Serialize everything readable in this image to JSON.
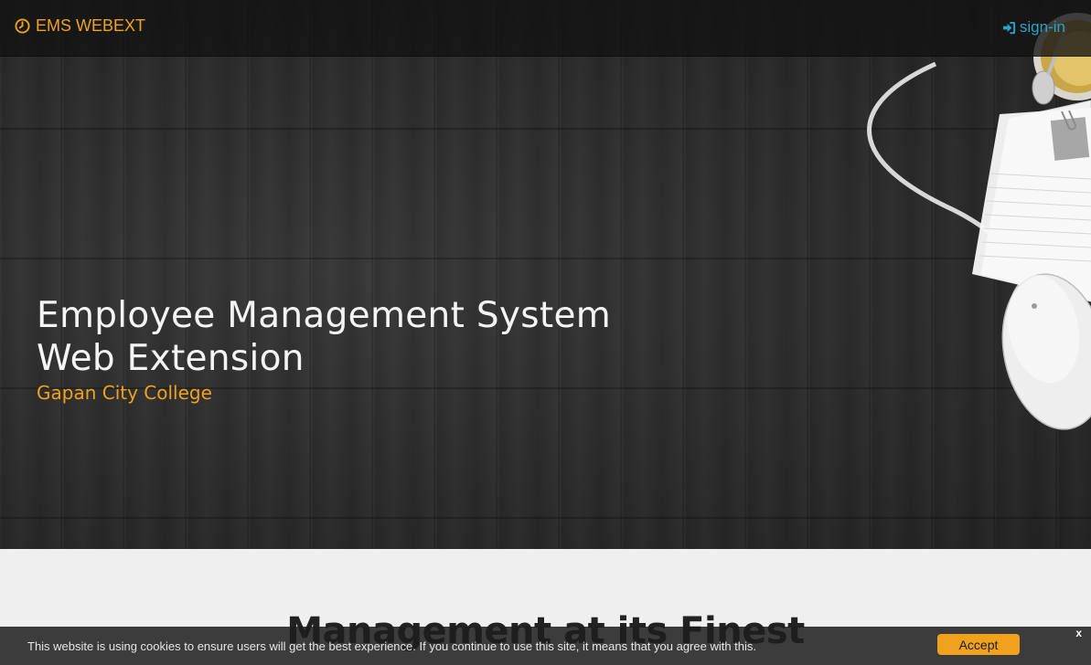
{
  "navbar": {
    "brand_icon": "clock-icon",
    "brand_text": "EMS WEBEXT",
    "signin_icon": "sign-in-icon",
    "signin_text": "sign-in"
  },
  "hero": {
    "title_line1": "Employee Management System",
    "title_line2": "Web Extension",
    "subtitle": "Gapan City College"
  },
  "section": {
    "title": "Management at its Finest"
  },
  "cookie_bar": {
    "message": "This website is using cookies to ensure users will get the best experience. If you continue to use this site, it means that you agree with this.",
    "accept_label": "Accept",
    "close_label": "x"
  },
  "colors": {
    "accent_orange": "#f0a11e",
    "link_blue": "#2aa3c9",
    "navbar_bg": "#121212",
    "section_bg": "#efefef"
  }
}
